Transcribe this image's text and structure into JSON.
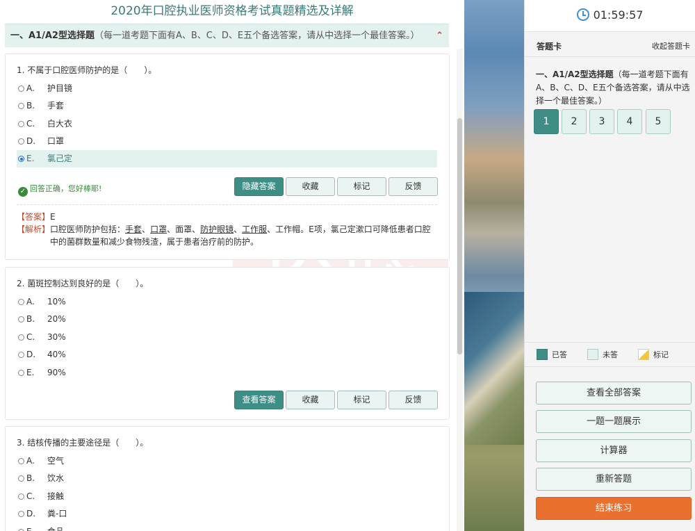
{
  "exam": {
    "title": "2020年口腔执业医师资格考试真题精选及详解",
    "section_title": "一、A1/A2型选择题",
    "section_desc": "（每一道考题下面有A、B、C、D、E五个备选答案，请从中选择一个最佳答案。）"
  },
  "questions": [
    {
      "stem": "1. 不属于口腔医师防护的是（　　）。",
      "options": [
        {
          "letter": "A.",
          "text": "护目镜"
        },
        {
          "letter": "B.",
          "text": "手套"
        },
        {
          "letter": "C.",
          "text": "白大衣"
        },
        {
          "letter": "D.",
          "text": "口罩"
        },
        {
          "letter": "E.",
          "text": "氯己定"
        }
      ],
      "selected": "E",
      "feedback": "回答正确，您好棒耶!",
      "answer_label": "【答案】",
      "answer_value": "E",
      "analysis_label": "【解析】",
      "analysis_parts": {
        "prefix": "口腔医师防护包括：",
        "u1": "手套",
        "s1": "、",
        "u2": "口罩",
        "s2": "、面罩、",
        "u3": "防护眼镜",
        "s3": "、",
        "u4": "工作服",
        "rest1": "、工作帽。E项，氯己定漱口可降低患者口腔",
        "rest2": "中的菌群数量和减少食物残渣，属于患者治疗前的防护。"
      }
    },
    {
      "stem": "2. 菌斑控制达到良好的是（　　）。",
      "options": [
        {
          "letter": "A.",
          "text": "10%"
        },
        {
          "letter": "B.",
          "text": "20%"
        },
        {
          "letter": "C.",
          "text": "30%"
        },
        {
          "letter": "D.",
          "text": "40%"
        },
        {
          "letter": "E.",
          "text": "90%"
        }
      ]
    },
    {
      "stem": "3. 结核传播的主要途径是（　　）。",
      "options": [
        {
          "letter": "A.",
          "text": "空气"
        },
        {
          "letter": "B.",
          "text": "饮水"
        },
        {
          "letter": "C.",
          "text": "接触"
        },
        {
          "letter": "D.",
          "text": "粪-口"
        },
        {
          "letter": "E.",
          "text": "食品"
        }
      ]
    }
  ],
  "buttons": {
    "hide_answer": "隐藏答案",
    "show_answer": "查看答案",
    "favorite": "收藏",
    "mark": "标记",
    "feedback": "反馈"
  },
  "sidebar": {
    "timer": "01:59:57",
    "card_title": "答题卡",
    "collapse": "收起答题卡",
    "section_title": "一、A1/A2型选择题",
    "section_desc": "（每一道考题下面有A、B、C、D、E五个备选答案，请从中选择一个最佳答案。）",
    "numbers": [
      "1",
      "2",
      "3",
      "4",
      "5"
    ],
    "legend": {
      "done": "已答",
      "todo": "未答",
      "mark": "标记"
    },
    "actions": {
      "view_all": "查看全部答案",
      "one_by_one": "一题一题展示",
      "calculator": "计算器",
      "restart": "重新答题",
      "finish": "结束练习"
    }
  },
  "watermark": "达聪",
  "colors": {
    "accent": "#3f8e86",
    "accent_light": "#e4f2ef",
    "finish": "#ea7030",
    "correct": "#3a8a3a"
  }
}
